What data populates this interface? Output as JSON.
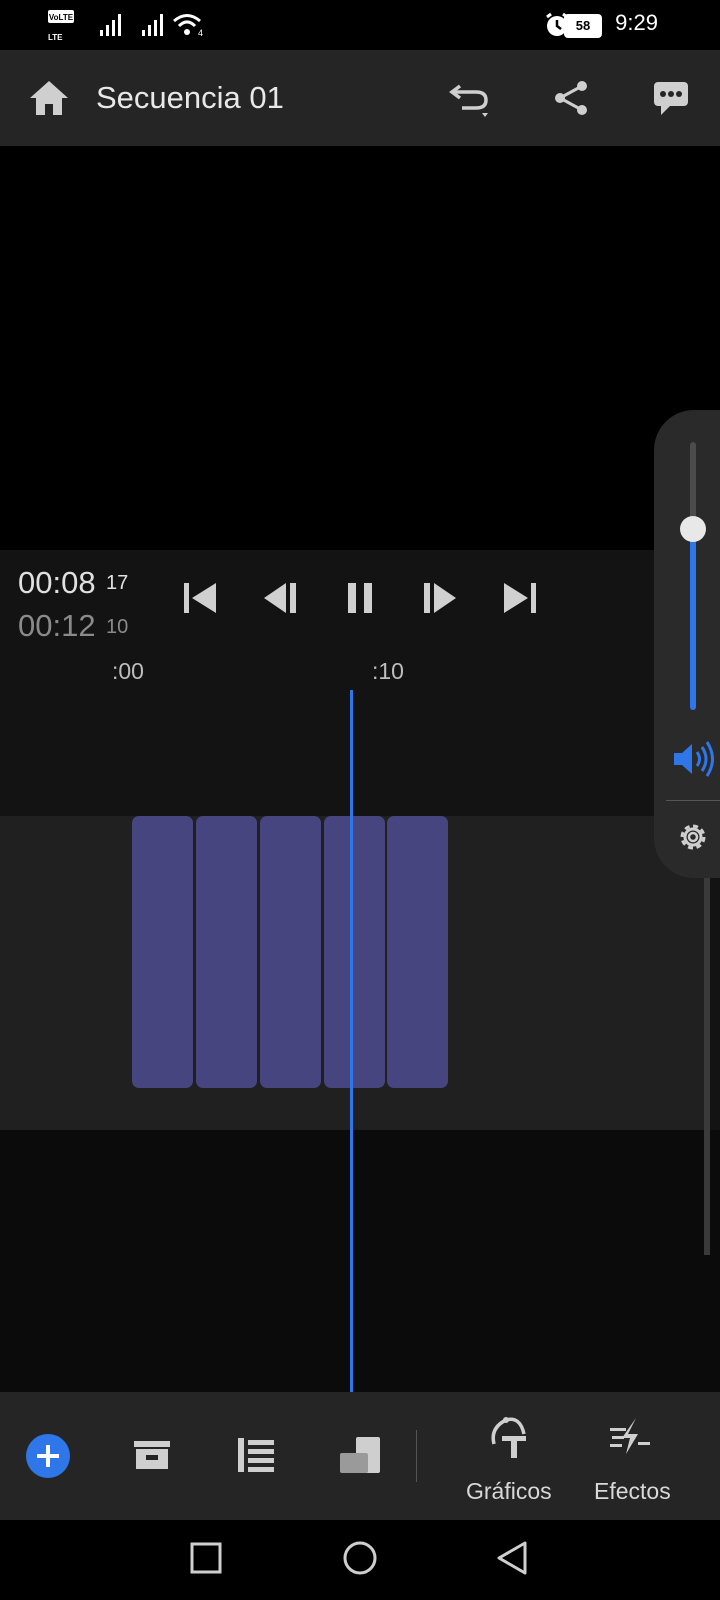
{
  "status_bar": {
    "time": "9:29",
    "battery": "58",
    "volte_label": "VoLTE",
    "lte_label": "LTE",
    "icons": [
      "volte-icon",
      "signal-icon",
      "signal-icon",
      "wifi-icon",
      "alarm-icon",
      "battery-icon"
    ]
  },
  "header": {
    "title": "Secuencia 01",
    "icons": [
      "home-icon",
      "undo-icon",
      "share-icon",
      "feedback-icon"
    ]
  },
  "transport": {
    "current_time": "00:08",
    "current_frames": "17",
    "duration": "00:12",
    "duration_frames": "10",
    "controls": [
      "skip-to-start-icon",
      "step-back-icon",
      "pause-icon",
      "step-forward-icon",
      "skip-to-end-icon"
    ]
  },
  "ruler": {
    "labels": [
      ":00",
      ":10"
    ]
  },
  "timeline": {
    "clip_count": 5,
    "clip_color": "#46457f",
    "playhead_color": "#2f76e8"
  },
  "volume_panel": {
    "level": 0.67,
    "icons": [
      "volume-icon",
      "settings-gear-icon"
    ]
  },
  "toolbar": {
    "icons": [
      "add-icon",
      "media-box-icon",
      "list-icon",
      "resize-icon",
      "graphics-icon",
      "effects-icon"
    ],
    "graphics_label": "Gráficos",
    "effects_label": "Efectos"
  },
  "nav_bar": {
    "icons": [
      "recents-square-icon",
      "home-circle-icon",
      "back-triangle-icon"
    ]
  },
  "colors": {
    "accent": "#2f76e8",
    "header_bg": "#252525",
    "clip": "#46457f"
  }
}
